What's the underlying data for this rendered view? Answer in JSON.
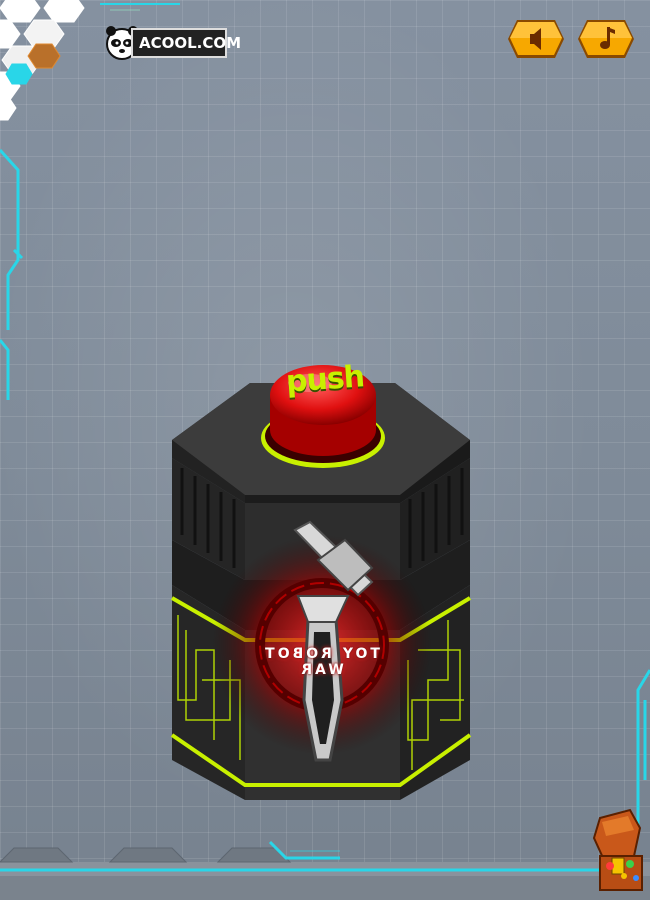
{
  "logo": {
    "text": "ACOOL.COM",
    "icon": "panda-icon"
  },
  "hud": {
    "sound_button": {
      "icon": "speaker-icon"
    },
    "music_button": {
      "icon": "music-note-icon"
    }
  },
  "machine": {
    "push_label": "push",
    "brand_text": "TOY ROBOT WAR"
  },
  "treasure": {
    "icon": "treasure-chest-icon"
  },
  "colors": {
    "accent_neon": "#c8f000",
    "cyan_frame": "#29d6e8",
    "button_red": "#e01010",
    "hud_orange": "#f5a000"
  }
}
